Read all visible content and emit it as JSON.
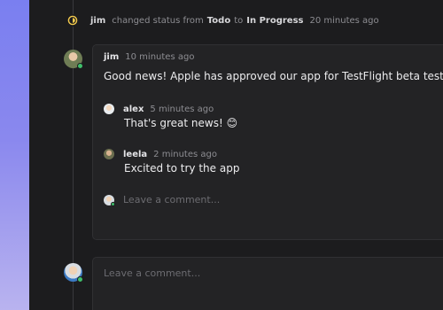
{
  "activity": {
    "actor": "jim",
    "text_changed": "changed status from",
    "from_status": "Todo",
    "text_to": "to",
    "to_status": "In Progress",
    "time": "20 minutes ago",
    "icon": "in-progress-status-icon",
    "icon_color": "#f2c94c"
  },
  "comment": {
    "author": "jim",
    "time": "10 minutes ago",
    "body": "Good news! Apple has approved our app for TestFlight beta testing this w",
    "replies": [
      {
        "author": "alex",
        "time": "5 minutes ago",
        "body": "That's great news! 😊"
      },
      {
        "author": "leela",
        "time": "2 minutes ago",
        "body": "Excited to try the app"
      }
    ],
    "reply_placeholder": "Leave a comment..."
  },
  "composer": {
    "placeholder": "Leave a comment..."
  },
  "colors": {
    "presence": "#3fbf6b",
    "background_panel": "#1c1c1e",
    "card": "#232325"
  }
}
